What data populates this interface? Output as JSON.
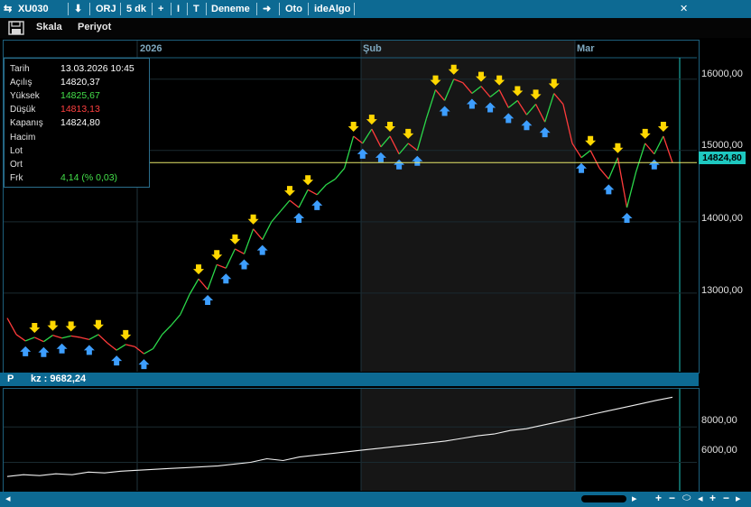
{
  "titlebar": {
    "symbol": "XU030",
    "orj": "ORJ",
    "period": "5 dk",
    "plus": "+",
    "cursor": "I",
    "text_tool": "T",
    "deneme": "Deneme",
    "arrow": "➜",
    "oto": "Oto",
    "idealgo": "ideAlgo",
    "close": "✕"
  },
  "toolbar": {
    "skala": "Skala",
    "periyot": "Periyot"
  },
  "xaxis": [
    "2026",
    "Şub",
    "Mar"
  ],
  "yaxis_main": [
    "16000,00",
    "15000,00",
    "14000,00",
    "13000,00"
  ],
  "yaxis_sub": [
    "8000,00",
    "6000,00"
  ],
  "current_price": "14824,80",
  "info": {
    "tarih_label": "Tarih",
    "tarih": "13.03.2026 10:45",
    "acilis_label": "Açılış",
    "acilis": "14820,37",
    "yuksek_label": "Yüksek",
    "yuksek": "14825,67",
    "dusuk_label": "Düşük",
    "dusuk": "14813,13",
    "kapanis_label": "Kapanış",
    "kapanis": "14824,80",
    "hacim_label": "Hacim",
    "lot_label": "Lot",
    "ort_label": "Ort",
    "frk_label": "Frk",
    "frk": "4,14 (% 0,03)"
  },
  "subpanel": {
    "p": "P",
    "kz": "kz : 9682,24"
  },
  "colors": {
    "up": "#2bd84a",
    "down": "#ff3b3b",
    "accent": "#0d6a93",
    "sell": "#ffd700",
    "buy": "#3d9eff"
  },
  "chart_data": {
    "type": "line",
    "title": "",
    "ylabel": "",
    "ylim": [
      12000,
      16300
    ],
    "x_labels": [
      "2026",
      "Şub",
      "Mar"
    ],
    "series": [
      {
        "values": [
          12650,
          12420,
          12330,
          12380,
          12320,
          12410,
          12370,
          12400,
          12380,
          12350,
          12420,
          12300,
          12200,
          12280,
          12250,
          12150,
          12220,
          12420,
          12550,
          12700,
          12980,
          13200,
          13050,
          13400,
          13350,
          13620,
          13550,
          13900,
          13750,
          14000,
          14150,
          14300,
          14200,
          14450,
          14380,
          14520,
          14600,
          14750,
          15200,
          15100,
          15300,
          15050,
          15200,
          14950,
          15100,
          15000,
          15450,
          15850,
          15700,
          16000,
          15950,
          15800,
          15900,
          15750,
          15850,
          15600,
          15700,
          15500,
          15650,
          15400,
          15800,
          15650,
          15100,
          14900,
          15000,
          14750,
          14600,
          14900,
          14200,
          14700,
          15100,
          14950,
          15200,
          14830
        ]
      },
      {
        "values": [
          5200,
          5300,
          5250,
          5350,
          5300,
          5450,
          5400,
          5500,
          5550,
          5600,
          5650,
          5700,
          5750,
          5800,
          5900,
          6000,
          6200,
          6100,
          6300,
          6400,
          6500,
          6600,
          6700,
          6800,
          6900,
          7000,
          7100,
          7200,
          7350,
          7500,
          7600,
          7800,
          7900,
          8100,
          8300,
          8500,
          8700,
          8900,
          9100,
          9300,
          9500,
          9682
        ]
      }
    ]
  }
}
